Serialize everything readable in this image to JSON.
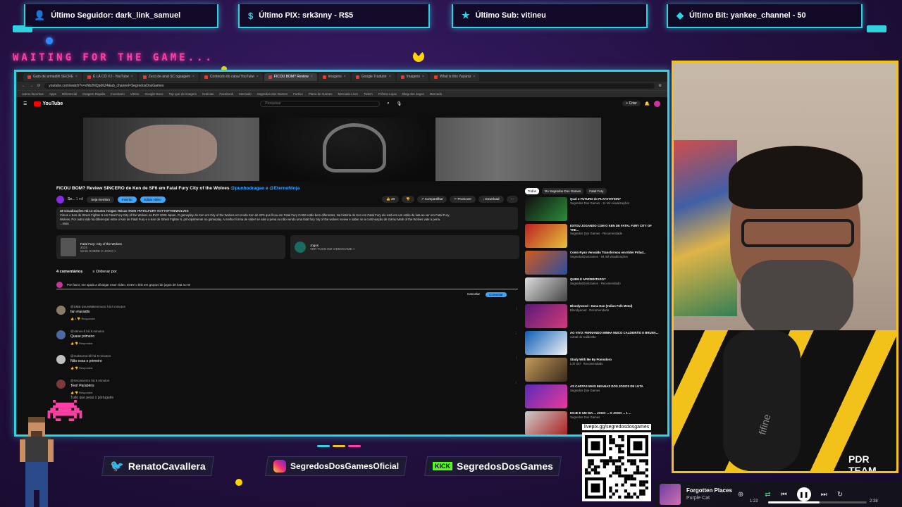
{
  "overlay": {
    "alerts": [
      {
        "icon": "user-icon",
        "label": "Último Seguidor: dark_link_samuel"
      },
      {
        "icon": "dollar-icon",
        "label": "Último PIX: srk3nny - R$5"
      },
      {
        "icon": "star-icon",
        "label": "Último Sub: vitineu"
      },
      {
        "icon": "diamond-icon",
        "label": "Último Bit: yankee_channel - 50"
      }
    ],
    "waiting_text": "WAITING FOR THE GAME...",
    "colors": {
      "accent_cyan": "#2fd3e0",
      "accent_pink": "#ff3fa6",
      "webcam_border": "#f0c419"
    }
  },
  "browser": {
    "tabs": [
      "Gato de armadilh SECRE",
      "É LÁ CÓ VJ - YouTube",
      "Zeca de anal SC ogsagem",
      "Conteúdo do canal YouTube",
      "FICOU BOM? Review",
      "Imagens",
      "Google Tradutor",
      "Imagens",
      "What is this Yayaniz"
    ],
    "active_tab": 4,
    "url": "youtube.com/watch?v=xNb2NQpd6Z4&ab_channel=SegredosDosGames",
    "bookmarks": [
      "outros favoritos",
      "Apps",
      "Diferencial",
      "Imagem Rapida",
      "Inventario",
      "Vitrine",
      "Google Docs",
      "Top que de imagem",
      "Notícias",
      "Facebook",
      "Mercado",
      "Segredos dos Games",
      "Furtivo",
      "Plano de Games",
      "Mercado Livre",
      "Twitch",
      "Prêmio Lojas",
      "Blog dos Jogos",
      "Mercado"
    ]
  },
  "youtube": {
    "logo": "YouTube",
    "search_placeholder": "Pesquisar",
    "create_label": "+ Criar",
    "video_title": "FICOU BOM? Review SINCERO de Ken de SF6 em Fatal Fury City of the Wolves",
    "video_title_links": "@punhodragao e @EternoNinja",
    "channel_name": "Se...",
    "subscribers": "1 mil",
    "join_label": "Seja membro",
    "subscribed_label": "Inscrito",
    "edit_label": "Editar vídeo",
    "actions": [
      "👍 28",
      "👎",
      "↗ Compartilhar",
      "✂ Promover",
      "↓ Download",
      "⋯"
    ],
    "desc_line1": "48 visualizações  Há 13 minutos  #Jogos #Dicas  #KEN #FATALFURY #CITYOFTHEWOLVES",
    "desc_line2": "Vimos o Ken de Street Fighter 6 em Fatal Fury City of the Wolves na EVO 2025 Japan. O gameplay do Ken em City of the Wolves em modo Ken de SF6 que ficou em Fatal Fury CotW estão bem diferentes. Na história do Ken em Fatal Fury ele está em um estilo de luta ao ver em Fatal Fury.",
    "desc_line3": "Wolves. Por outro lado há diferenças entre o Ken de Fatal Fury e o Ken de Street Fighter 6, principalmente no gameplay. A melhor forma de saber se vale a pena ou não vendo uma fatal fury city of the wolves review e saber se a continuação de Garou Mark of the Wolves vale a pena.",
    "desc_more": "...mais",
    "card_game_title": "Fatal Fury: City of the Wolves",
    "card_game_year": "2025",
    "card_game_link": "MAIS SOBRE O JOGO >",
    "card_category_title": "Jogos",
    "card_category_link": "VER TUDO EM VIDEOGAME >",
    "comments_count": "4 comentários",
    "sort_label": "Ordenar por",
    "comment_input": "Por favor, me ajuda a divulgar esse vídeo. Entre o link em grupos de jogos de luta no W",
    "cancel_label": "Cancelar",
    "comment_label": "Comentar",
    "comments": [
      {
        "author": "@SMB-ZeusMakesmusic há 6 minutos",
        "text": "fan muraidlo",
        "actions": "👍 1  👎  Responder"
      },
      {
        "author": "@vitineu-ll há 9 minutos",
        "text": "Quase primeiro",
        "actions": "👍  👎  Responder"
      },
      {
        "author": "@maksuma-bll há 9 minutos",
        "text": "Não essa o primeiro",
        "actions": "👍  👎  Responder"
      },
      {
        "author": "@GvUniverzo há 9 minutos",
        "text": "Teori Parabéns",
        "actions": "👍  👎  Responder"
      }
    ],
    "last_comment_extra": "Tudo que pesa o português",
    "chips": [
      "Todos",
      "Do Segredos Dos Games",
      "Fatal Fury"
    ],
    "related": [
      {
        "title": "Qual o FUTURO do PLAYSTATION?",
        "sub": "Segredos Dos Games · 11 mil visualizações"
      },
      {
        "title": "ESTOU JOGANDO COM O KEN DE FATAL FURY CITY OF THE...",
        "sub": "Segredos Dos Games · Recomendado"
      },
      {
        "title": "Como Ryan Venvaldo Transformou em Elder Prilad...",
        "sub": "SegredosDosGames · 64 mil visualizações"
      },
      {
        "title": "QUEM É APOSENTADO?",
        "sub": "SegredosDosGames · Recomendado"
      },
      {
        "title": "Bloodywood - Dana Dan (Indian Folk Metal)",
        "sub": "Bloodywood · Recomendado"
      },
      {
        "title": "AO VIVO: FERNANDO MINHA MUCO CALDEIRÃO E BRUNA...",
        "sub": "Canal do Caldeirão"
      },
      {
        "title": "Study With Me By Pomodoro",
        "sub": "Lofi Girl · Recomendado"
      },
      {
        "title": "AS CARTAS MAIS INSANAS DOS JOGOS DE LUTA",
        "sub": "Segredos Dos Games"
      },
      {
        "title": "HOJE E UM DIA ... JOGO ... O JOGO ... 1 ...",
        "sub": "Segredos Dos Games"
      }
    ]
  },
  "webcam": {
    "shirt_text": "PDR TEAM",
    "mic_brand": "fifine"
  },
  "socials": [
    {
      "icon": "twitter-icon",
      "handle": "RenatoCavallera"
    },
    {
      "icon": "instagram-icon",
      "handle": "SegredosDosGamesOficial"
    },
    {
      "icon": "kick-icon",
      "badge": "KICK",
      "handle": "SegredosDosGames"
    }
  ],
  "qr_label": "livepix.gg/segredosdosgames",
  "music": {
    "title": "Forgotten Places",
    "artist": "Purple Cat",
    "elapsed": "1:22",
    "duration": "2:38",
    "progress": 0.52
  }
}
